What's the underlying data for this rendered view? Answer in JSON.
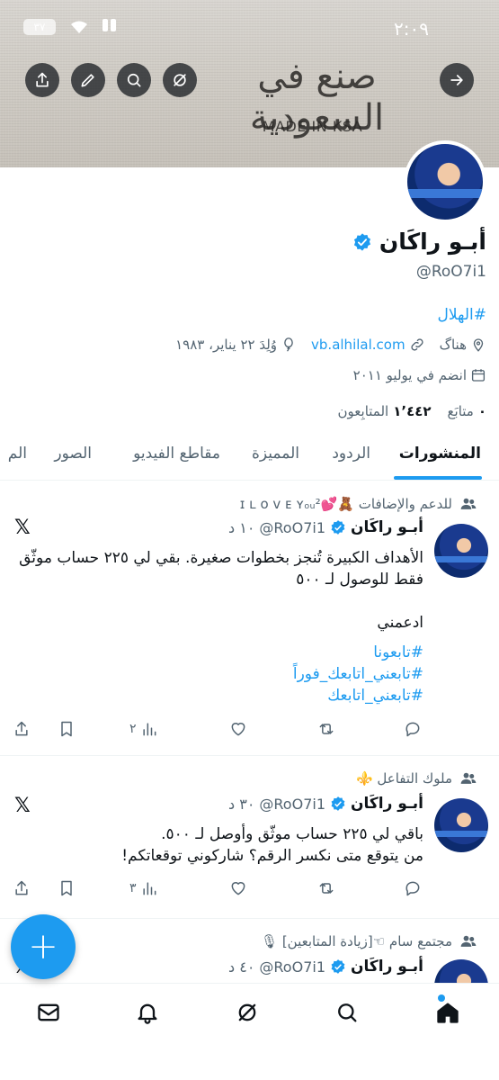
{
  "status_bar": {
    "time": "٢:٠٩",
    "battery": "٣٧"
  },
  "banner": {
    "title": "صنع في السعودية",
    "subtitle": "MADE IN KSA"
  },
  "profile": {
    "display_name": "أبـو راكَان",
    "handle": "@RoO7i1",
    "bio": "#الهلال",
    "location": "هناگ",
    "website": "vb.alhilal.com",
    "birthday": "وُلِدَ ٢٢ يناير، ١٩٨٣",
    "joined": "انضم في يوليو ٢٠١١",
    "following_count": "٠",
    "following_label": "متابَع",
    "followers_count": "١٬٤٤٢",
    "followers_label": "المتابِعون"
  },
  "tabs": [
    "المنشورات",
    "الردود",
    "المميزة",
    "مقاطع الفيديو",
    "الصور",
    "الم"
  ],
  "posts": [
    {
      "community": "للدعم والإضافات 🧸💕ɪ ʟ ᴏ ᴠ ᴇ ʏₒᵤ²",
      "name": "أبـو راكَان",
      "handle": "@RoO7i1",
      "time": "١٠ د",
      "text": "الأهداف الكبيرة تُنجز بخطوات صغيرة. بقي لي ٢٢٥ حساب موثّق فقط للوصول لـ ٥٠٠\n\nادعمني",
      "tags": [
        "#تابعونا",
        "#تابعني_اتابعك_فوراً",
        "#تابعني_اتابعك"
      ],
      "views": "٢"
    },
    {
      "community": "ملوك التفاعل ⚜️",
      "name": "أبـو راكَان",
      "handle": "@RoO7i1",
      "time": "٣٠ د",
      "text": "باقي لي ٢٢٥ حساب موثّق وأوصل لـ ٥٠٠.\nمن يتوقع متى نكسر الرقم؟ شاركوني توقعاتكم!",
      "views": "٣"
    },
    {
      "community": "مجتمع سام ☜[زيادة المتابعين] 🎙",
      "name": "أبـو راكَان",
      "handle": "@RoO7i1",
      "time": "٤٠ د"
    }
  ],
  "x_logo": "𝕏",
  "fab_label": "+",
  "colors": {
    "accent": "#1d9bf0",
    "text": "#0f1419",
    "secondary": "#536471"
  }
}
